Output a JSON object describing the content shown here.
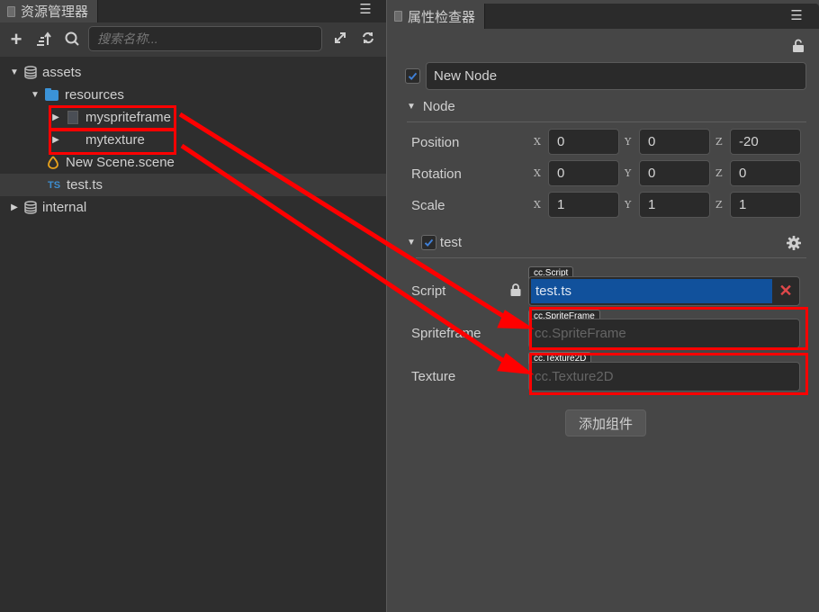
{
  "assets_panel": {
    "tab_title": "资源管理器",
    "search_placeholder": "搜索名称...",
    "tree": [
      {
        "label": "assets",
        "icon": "database-icon",
        "expanded": true,
        "level": 0
      },
      {
        "label": "resources",
        "icon": "folder-icon",
        "expanded": true,
        "level": 1
      },
      {
        "label": "myspriteframe",
        "icon": "spriteframe-icon",
        "expanded": false,
        "level": 2
      },
      {
        "label": "mytexture",
        "icon": "texture-icon",
        "expanded": false,
        "level": 2
      },
      {
        "label": "New Scene.scene",
        "icon": "scene-icon",
        "level": 2
      },
      {
        "label": "test.ts",
        "icon": "typescript-icon",
        "icon_text": "TS",
        "level": 2,
        "selected": true
      },
      {
        "label": "internal",
        "icon": "database-icon",
        "expanded": false,
        "level": 0
      }
    ]
  },
  "inspector": {
    "tab_title": "属性检查器",
    "node_active": true,
    "node_name": "New Node",
    "node_section": "Node",
    "transform": [
      {
        "label": "Position",
        "x": "0",
        "y": "0",
        "z": "-20"
      },
      {
        "label": "Rotation",
        "x": "0",
        "y": "0",
        "z": "0"
      },
      {
        "label": "Scale",
        "x": "1",
        "y": "1",
        "z": "1"
      }
    ],
    "axis_labels": {
      "x": "X",
      "y": "Y",
      "z": "Z"
    },
    "component": {
      "name": "test",
      "enabled": true,
      "props": [
        {
          "label": "Script",
          "type_tag": "cc.Script",
          "value": "test.ts",
          "locked": true
        },
        {
          "label": "Spriteframe",
          "type_tag": "cc.SpriteFrame",
          "placeholder": "cc.SpriteFrame"
        },
        {
          "label": "Texture",
          "type_tag": "cc.Texture2D",
          "placeholder": "cc.Texture2D"
        }
      ]
    },
    "add_component_label": "添加组件"
  },
  "annotations": {
    "color": "#ff0000",
    "arrows": [
      {
        "from": "myspriteframe",
        "to": "Spriteframe"
      },
      {
        "from": "mytexture",
        "to": "Texture"
      }
    ]
  }
}
